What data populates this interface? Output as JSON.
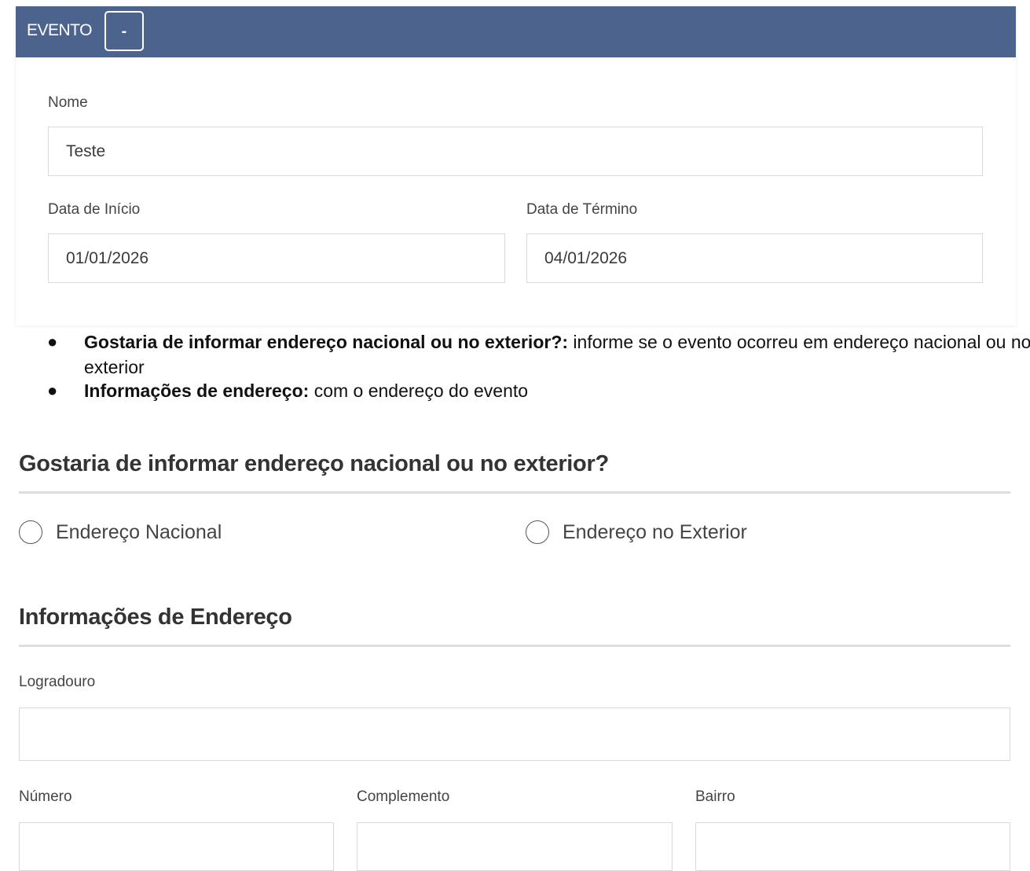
{
  "event_panel": {
    "title": "EVENTO",
    "collapse_label": "-",
    "fields": {
      "name": {
        "label": "Nome",
        "value": "Teste"
      },
      "start_date": {
        "label": "Data de Início",
        "value": "01/01/2026"
      },
      "end_date": {
        "label": "Data de Término",
        "value": "04/01/2026"
      }
    }
  },
  "instructions": [
    {
      "bold": "Gostaria de informar endereço nacional ou no exterior?:",
      "text": " informe se o evento ocorreu em endereço nacional ou no exterior"
    },
    {
      "bold": "Informações de endereço:",
      "text": " com o endereço do evento"
    }
  ],
  "address_type_section": {
    "title": "Gostaria de informar endereço nacional ou no exterior?",
    "options": [
      {
        "label": "Endereço Nacional",
        "selected": false
      },
      {
        "label": "Endereço no Exterior",
        "selected": false
      }
    ]
  },
  "address_section": {
    "title": "Informações de Endereço",
    "fields": {
      "street": {
        "label": "Logradouro",
        "value": ""
      },
      "number": {
        "label": "Número",
        "value": ""
      },
      "complement": {
        "label": "Complemento",
        "value": ""
      },
      "neighborhood": {
        "label": "Bairro",
        "value": ""
      }
    }
  },
  "colors": {
    "header_bg": "#4c648d",
    "header_text": "#ffffff",
    "input_border": "#d9d9d9",
    "rule": "#dedede"
  }
}
